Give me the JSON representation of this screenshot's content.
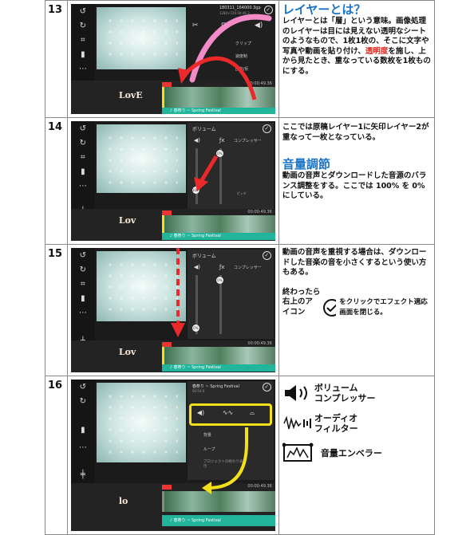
{
  "step13": {
    "number": "13",
    "title": "レイヤーとは？",
    "body_pre": "レイヤーとは「層」という意味。画像処理のレイヤーは目には見えない透明なシートのようなもので、1枚1枚の、そこに文字や写真や動画を貼り付け、",
    "body_red": "透明度",
    "body_post": "を施し、上から見たとき、重なっている数枚を1枚ものにする。",
    "screen": {
      "file_name": "180311_164000.3gp",
      "file_info": "1280×720 00:49.3",
      "menu_item_1": "クリップ",
      "menu_item_2": "速度制",
      "menu_item_3": "回転/反",
      "clip_text": "LovE",
      "audio_label": "♪ 春祭り ~ Spring Festival",
      "time": "00:00:49.36"
    }
  },
  "step14": {
    "number": "14",
    "body": "ここでは原稿レイヤー1に矢印レイヤー2が重なって一枚となっている。",
    "heading": "音量調節",
    "body2": "動画の音声とダウンロードした音源のバランス調整をする。ここでは 100% を 0% にしている。",
    "screen": {
      "panel_title": "ボリューム",
      "compressor": "コンプレッサー",
      "pct_0": "0%",
      "pct_100": "100%",
      "pitch": "ピッチ",
      "clip_text": "Lov",
      "audio_label": "♪ 春祭り ~ Spring Festival",
      "time": "00:00:49.36"
    }
  },
  "step15": {
    "number": "15",
    "body": "動画の音声を重視する場合は、ダウンロードした音楽の音を小さくするという使い方もある。",
    "body2_a": "終わったら",
    "body2_b": "右上のアイコン",
    "body2_c": "をクリックでエフェクト適応画面を閉じる。",
    "screen": {
      "panel_title": "ボリューム",
      "compressor": "コンプレッサー",
      "pct_0": "0%",
      "clip_text": "Lov",
      "audio_label": "♪ 春祭り ~ Spring Festival",
      "time": "00:00:49.36"
    }
  },
  "step16": {
    "number": "16",
    "legend": [
      {
        "icon": "volume-icon",
        "label": "ボリューム\nコンプレッサー"
      },
      {
        "icon": "audio-filter-icon",
        "label": "オーディオ\nフィルター"
      },
      {
        "icon": "equalizer-icon",
        "label": "音量エンベラー"
      }
    ],
    "screen": {
      "audio_title": "春祭り ~ Spring Festival",
      "audio_len": "00:54.0",
      "bg_label": "背景",
      "loop_label": "ループ",
      "project_label": "プロジェクトの終わり表示",
      "clip_text": "lo",
      "audio_label": "♪ 春祭り ~ Spring Festival",
      "time": "00:00:49.36"
    }
  },
  "colors": {
    "heading_blue": "#1a73c6",
    "accent_red": "#e0241c",
    "highlight_yellow": "#f2e11a",
    "pink_arrow": "#f28bc8",
    "audio_teal": "#22b59c"
  }
}
